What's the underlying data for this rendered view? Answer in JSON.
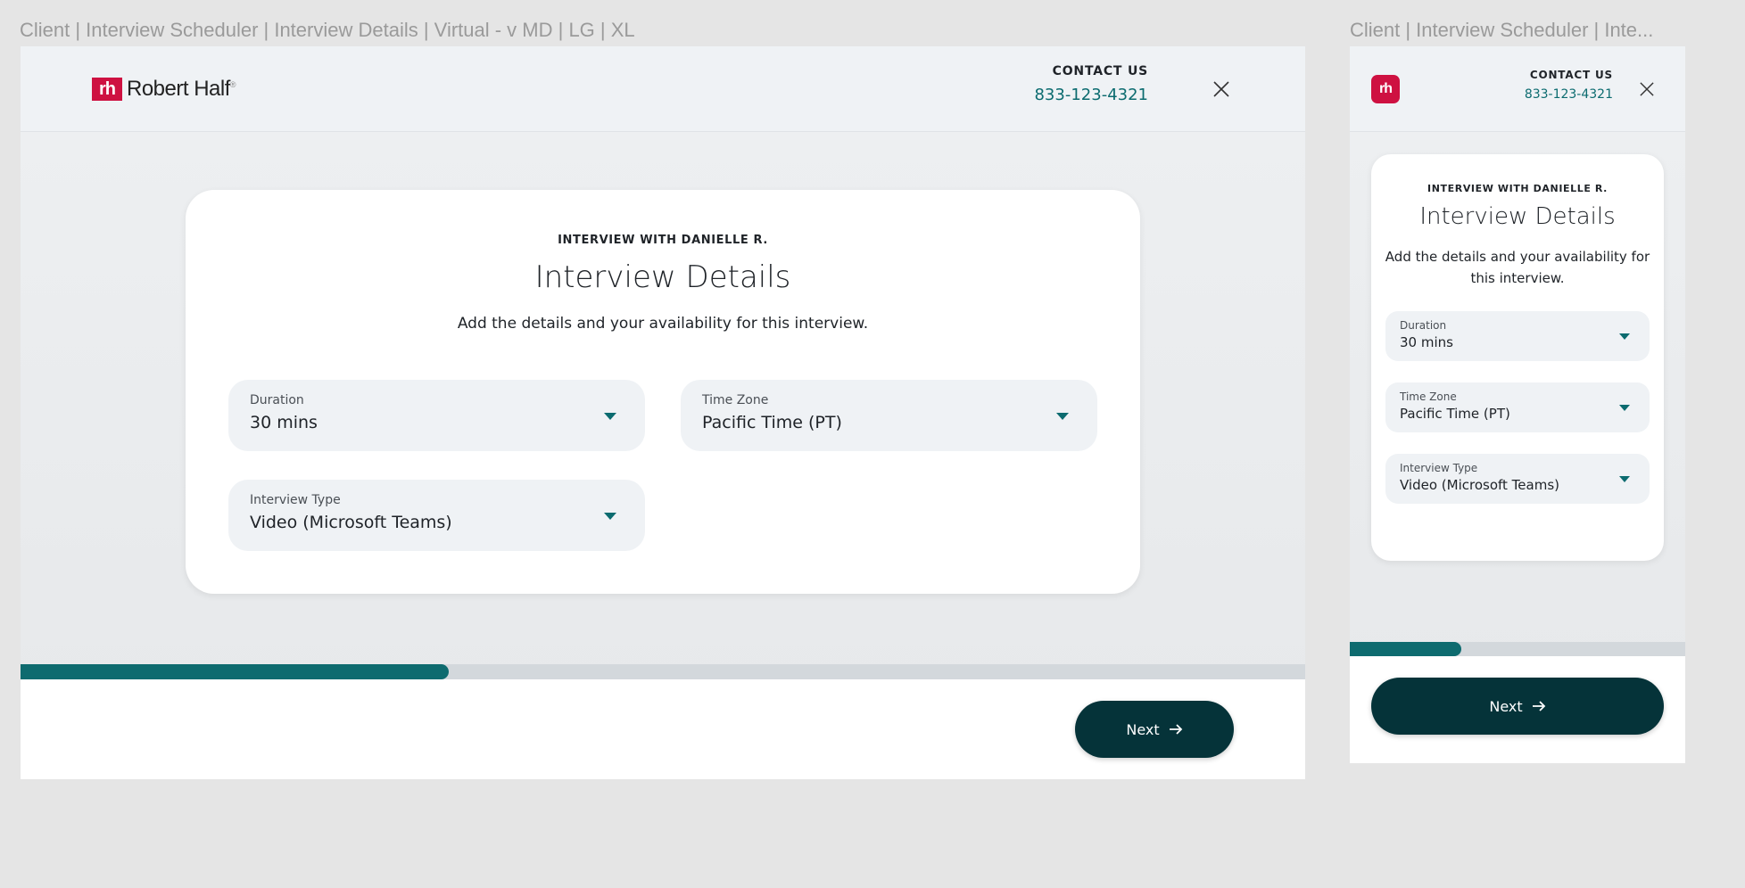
{
  "frames": {
    "desktop_label": "Client | Interview Scheduler | Interview Details | Virtual - v MD | LG | XL",
    "mobile_label": "Client | Interview Scheduler | Inte..."
  },
  "brand": {
    "logo_mark": "rh",
    "logo_word": "Robert Half",
    "logo_reg": "®",
    "accent": "#ce1141",
    "teal": "#0b6b6f",
    "dark": "#053339"
  },
  "header": {
    "contact_label": "CONTACT US",
    "phone": "833-123-4321",
    "close_icon": "close-icon"
  },
  "card": {
    "eyebrow": "INTERVIEW WITH DANIELLE R.",
    "title": "Interview Details",
    "subtitle": "Add the details and your availability for this interview."
  },
  "fields": {
    "duration": {
      "label": "Duration",
      "value": "30 mins"
    },
    "timezone": {
      "label": "Time Zone",
      "value": "Pacific Time (PT)"
    },
    "interview_type": {
      "label": "Interview Type",
      "value": "Video (Microsoft Teams)"
    }
  },
  "progress": {
    "desktop_fraction": 0.333,
    "mobile_fraction": 0.333
  },
  "footer": {
    "next_label": "Next"
  }
}
